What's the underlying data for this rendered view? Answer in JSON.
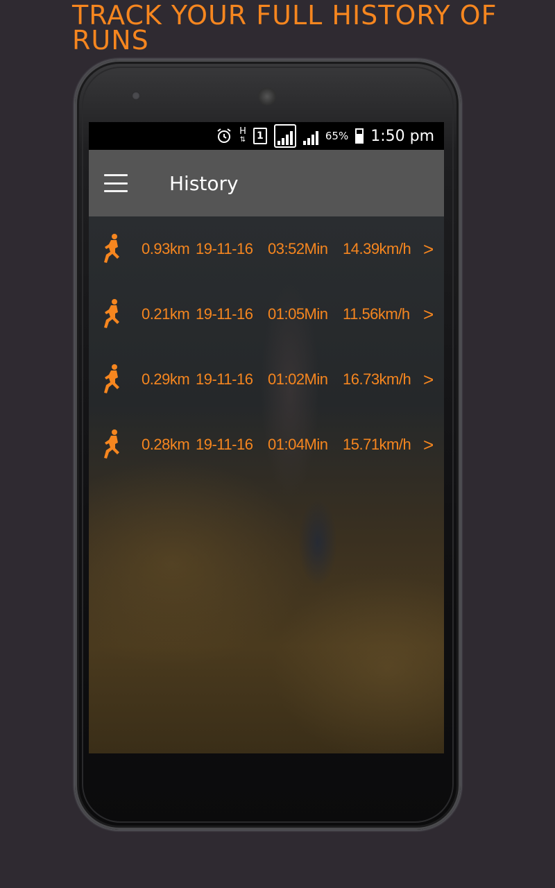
{
  "promo": {
    "headline": "TRACK YOUR FULL HISTORY OF RUNS"
  },
  "statusbar": {
    "network_type": "H",
    "sim_slot": "1",
    "battery_percent": "65%",
    "time": "1:50 pm",
    "icons": [
      "alarm-icon",
      "network-type-icon",
      "sim-icon",
      "signal-icon",
      "signal-icon",
      "battery-icon"
    ]
  },
  "appbar": {
    "title": "History",
    "menu_icon": "hamburger-menu-icon"
  },
  "colors": {
    "accent": "#f6861f",
    "appbar": "#555555",
    "background": "#2f2a31"
  },
  "runs": [
    {
      "distance": "0.93km",
      "date": "19-11-16",
      "duration": "03:52Min",
      "speed": "14.39km/h",
      "chevron": ">"
    },
    {
      "distance": "0.21km",
      "date": "19-11-16",
      "duration": "01:05Min",
      "speed": "11.56km/h",
      "chevron": ">"
    },
    {
      "distance": "0.29km",
      "date": "19-11-16",
      "duration": "01:02Min",
      "speed": "16.73km/h",
      "chevron": ">"
    },
    {
      "distance": "0.28km",
      "date": "19-11-16",
      "duration": "01:04Min",
      "speed": "15.71km/h",
      "chevron": ">"
    }
  ]
}
